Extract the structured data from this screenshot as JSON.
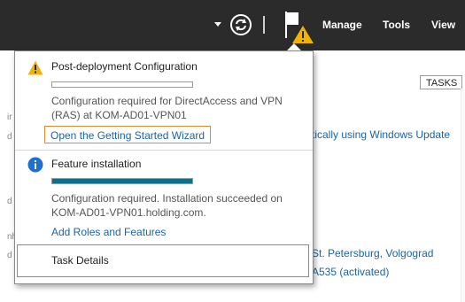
{
  "toolbar": {
    "menu": [
      {
        "label": "Manage"
      },
      {
        "label": "Tools"
      },
      {
        "label": "View"
      }
    ]
  },
  "background": {
    "tasks_button": "TASKS",
    "link_windows_update": "tically using Windows Update",
    "link_timezone": "St. Petersburg, Volgograd",
    "link_activation": "A535 (activated)"
  },
  "notifications": {
    "post_deployment": {
      "title": "Post-deployment Configuration",
      "progress": 0,
      "message_line1": "Configuration required for DirectAccess and VPN",
      "message_line2": "(RAS) at KOM-AD01-VPN01",
      "link": "Open the Getting Started Wizard"
    },
    "feature_installation": {
      "title": "Feature installation",
      "progress": 1.0,
      "message_line1": "Configuration required. Installation succeeded on",
      "message_line2": "KOM-AD01-VPN01.holding.com.",
      "link": "Add Roles and Features"
    },
    "task_details_label": "Task Details"
  },
  "colors": {
    "toolbar_bg": "#2b2b2b",
    "link": "#1a64a8",
    "progress_fill": "#0e6f8c",
    "warning": "#f0b400",
    "info": "#1f6fd1",
    "focus_border": "#e08a2c"
  }
}
